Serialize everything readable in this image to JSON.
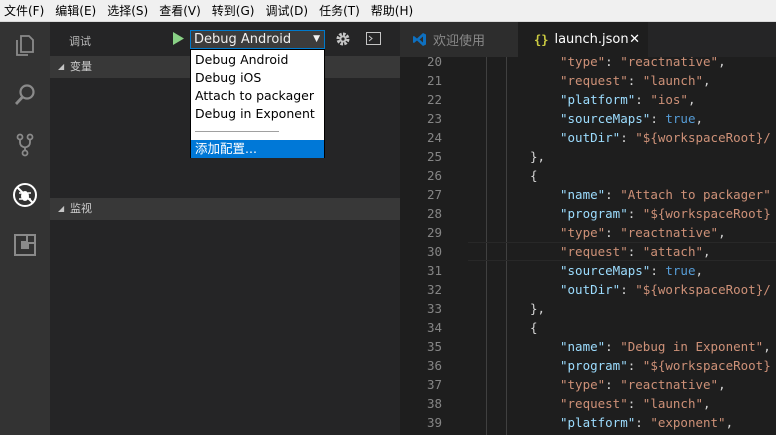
{
  "menu": [
    "文件(F)",
    "编辑(E)",
    "选择(S)",
    "查看(V)",
    "转到(G)",
    "调试(D)",
    "任务(T)",
    "帮助(H)"
  ],
  "sidebar": {
    "title": "调试",
    "selected_config": "Debug Android",
    "variables_label": "变量",
    "watch_label": "监视"
  },
  "dropdown": {
    "items": [
      "Debug Android",
      "Debug iOS",
      "Attach to packager",
      "Debug in Exponent"
    ],
    "add_config": "添加配置..."
  },
  "tabs": [
    {
      "label": "欢迎使用",
      "active": false
    },
    {
      "label": "launch.json",
      "active": true
    }
  ],
  "editor": {
    "lines": [
      {
        "n": "20",
        "indent": 1,
        "parts": [
          [
            "s",
            "\"type\""
          ],
          [
            "p",
            ": "
          ],
          [
            "s",
            "\"reactnative\""
          ],
          [
            "p",
            ","
          ]
        ]
      },
      {
        "n": "21",
        "indent": 1,
        "parts": [
          [
            "s",
            "\"request\""
          ],
          [
            "p",
            ": "
          ],
          [
            "s",
            "\"launch\""
          ],
          [
            "p",
            ","
          ]
        ]
      },
      {
        "n": "22",
        "indent": 1,
        "parts": [
          [
            "k",
            "\"platform\""
          ],
          [
            "p",
            ": "
          ],
          [
            "s",
            "\"ios\""
          ],
          [
            "p",
            ","
          ]
        ]
      },
      {
        "n": "23",
        "indent": 1,
        "parts": [
          [
            "k",
            "\"sourceMaps\""
          ],
          [
            "p",
            ": "
          ],
          [
            "b",
            "true"
          ],
          [
            "p",
            ","
          ]
        ]
      },
      {
        "n": "24",
        "indent": 1,
        "parts": [
          [
            "k",
            "\"outDir\""
          ],
          [
            "p",
            ": "
          ],
          [
            "s",
            "\"${workspaceRoot}/"
          ]
        ]
      },
      {
        "n": "25",
        "indent": 0,
        "parts": [
          [
            "p",
            "},"
          ]
        ]
      },
      {
        "n": "26",
        "indent": 0,
        "parts": [
          [
            "p",
            "{"
          ]
        ]
      },
      {
        "n": "27",
        "indent": 1,
        "parts": [
          [
            "k",
            "\"name\""
          ],
          [
            "p",
            ": "
          ],
          [
            "s",
            "\"Attach to packager\""
          ]
        ]
      },
      {
        "n": "28",
        "indent": 1,
        "parts": [
          [
            "k",
            "\"program\""
          ],
          [
            "p",
            ": "
          ],
          [
            "s",
            "\"${workspaceRoot}"
          ]
        ]
      },
      {
        "n": "29",
        "indent": 1,
        "parts": [
          [
            "s",
            "\"type\""
          ],
          [
            "p",
            ": "
          ],
          [
            "s",
            "\"reactnative\""
          ],
          [
            "p",
            ","
          ]
        ]
      },
      {
        "n": "30",
        "indent": 1,
        "parts": [
          [
            "s",
            "\"request\""
          ],
          [
            "p",
            ": "
          ],
          [
            "s",
            "\"attach\""
          ],
          [
            "p",
            ","
          ]
        ]
      },
      {
        "n": "31",
        "indent": 1,
        "parts": [
          [
            "k",
            "\"sourceMaps\""
          ],
          [
            "p",
            ": "
          ],
          [
            "b",
            "true"
          ],
          [
            "p",
            ","
          ]
        ]
      },
      {
        "n": "32",
        "indent": 1,
        "parts": [
          [
            "k",
            "\"outDir\""
          ],
          [
            "p",
            ": "
          ],
          [
            "s",
            "\"${workspaceRoot}/"
          ]
        ]
      },
      {
        "n": "33",
        "indent": 0,
        "parts": [
          [
            "p",
            "},"
          ]
        ]
      },
      {
        "n": "34",
        "indent": 0,
        "parts": [
          [
            "p",
            "{"
          ]
        ]
      },
      {
        "n": "35",
        "indent": 1,
        "parts": [
          [
            "k",
            "\"name\""
          ],
          [
            "p",
            ": "
          ],
          [
            "s",
            "\"Debug in Exponent\""
          ],
          [
            "p",
            ","
          ]
        ]
      },
      {
        "n": "36",
        "indent": 1,
        "parts": [
          [
            "k",
            "\"program\""
          ],
          [
            "p",
            ": "
          ],
          [
            "s",
            "\"${workspaceRoot}"
          ]
        ]
      },
      {
        "n": "37",
        "indent": 1,
        "parts": [
          [
            "s",
            "\"type\""
          ],
          [
            "p",
            ": "
          ],
          [
            "s",
            "\"reactnative\""
          ],
          [
            "p",
            ","
          ]
        ]
      },
      {
        "n": "38",
        "indent": 1,
        "parts": [
          [
            "s",
            "\"request\""
          ],
          [
            "p",
            ": "
          ],
          [
            "s",
            "\"launch\""
          ],
          [
            "p",
            ","
          ]
        ]
      },
      {
        "n": "39",
        "indent": 1,
        "parts": [
          [
            "k",
            "\"platform\""
          ],
          [
            "p",
            ": "
          ],
          [
            "s",
            "\"exponent\""
          ],
          [
            "p",
            ","
          ]
        ]
      }
    ],
    "current_line": "30"
  },
  "icons": {
    "explorer": "files-icon",
    "search": "search-icon",
    "scm": "source-control-icon",
    "debug": "debug-icon",
    "extensions": "extensions-icon"
  },
  "colors": {
    "accent": "#007acc",
    "run_green": "#89d185",
    "dropdown_selection": "#0078d7",
    "json_key": "#9cdcfe",
    "json_string": "#ce9178",
    "json_keyword": "#569cd6"
  }
}
